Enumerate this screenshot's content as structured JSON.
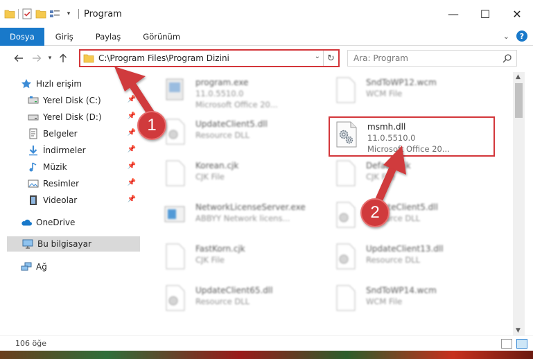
{
  "window": {
    "title": "Program",
    "controls": {
      "minimize": "—",
      "maximize": "☐",
      "close": "✕"
    }
  },
  "ribbon": {
    "tabs": [
      {
        "label": "Dosya",
        "active": true
      },
      {
        "label": "Giriş"
      },
      {
        "label": "Paylaş"
      },
      {
        "label": "Görünüm"
      }
    ],
    "expand_icon": "chevron-down-icon",
    "help_label": "?"
  },
  "nav": {
    "back_icon": "arrow-left-icon",
    "forward_icon": "arrow-right-icon",
    "recent_icon": "chevron-down-icon",
    "up_icon": "arrow-up-icon",
    "address_path": "C:\\Program Files\\Program Dizini",
    "search_placeholder": "Ara: Program"
  },
  "sidebar": {
    "quick_access": "Hızlı erişim",
    "items": [
      {
        "label": "Yerel Disk (C:)",
        "icon": "drive-icon",
        "pinned": true
      },
      {
        "label": "Yerel Disk (D:)",
        "icon": "drive-icon",
        "pinned": true
      },
      {
        "label": "Belgeler",
        "icon": "documents-icon",
        "pinned": true
      },
      {
        "label": "İndirmeler",
        "icon": "downloads-icon",
        "pinned": true
      },
      {
        "label": "Müzik",
        "icon": "music-icon",
        "pinned": true
      },
      {
        "label": "Resimler",
        "icon": "pictures-icon",
        "pinned": true
      },
      {
        "label": "Videolar",
        "icon": "videos-icon",
        "pinned": true
      }
    ],
    "onedrive": "OneDrive",
    "this_pc": "Bu bilgisayar",
    "network": "Ağ"
  },
  "files": {
    "left": [
      {
        "name": "program.exe",
        "line2": "11.0.5510.0",
        "line3": "Microsoft Office 20..."
      },
      {
        "name": "UpdateClient5.dll",
        "line2": "Resource DLL"
      },
      {
        "name": "Korean.cjk",
        "line2": "CJK File"
      },
      {
        "name": "NetworkLicenseServer.exe",
        "line2": "ABBYY Network licens..."
      },
      {
        "name": "FastKorn.cjk",
        "line2": "CJK File"
      },
      {
        "name": "UpdateClient65.dll",
        "line2": "Resource DLL"
      }
    ],
    "right": [
      {
        "name": "SndToWP12.wcm",
        "line2": "WCM File"
      },
      {
        "name": "msmh.dll",
        "line2": "11.0.5510.0",
        "line3": "Microsoft Office 20...",
        "highlighted": true
      },
      {
        "name": "Default.cjk",
        "line2": "CJK File"
      },
      {
        "name": "UpdateClient5.dll",
        "line2": "Resource DLL"
      },
      {
        "name": "UpdateClient13.dll",
        "line2": "Resource DLL"
      },
      {
        "name": "SndToWP14.wcm",
        "line2": "WCM File"
      }
    ]
  },
  "status": {
    "count": "106 öğe"
  },
  "annotations": {
    "step1": "1",
    "step2": "2",
    "color": "#d03a3c"
  }
}
